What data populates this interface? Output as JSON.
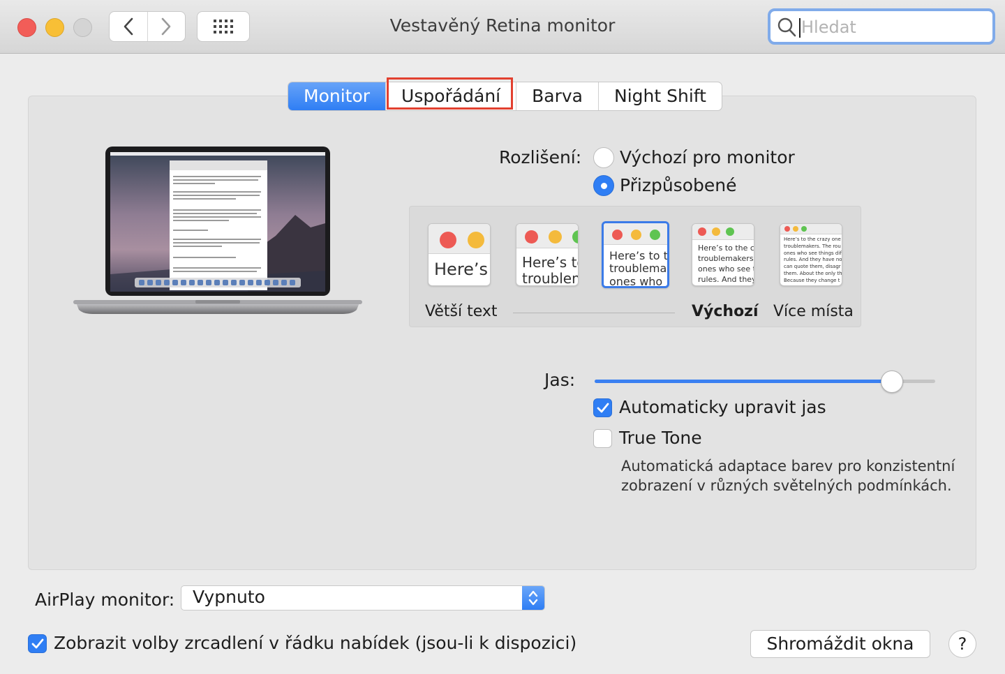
{
  "window": {
    "title": "Vestavěný Retina monitor",
    "search_placeholder": "Hledat",
    "icons": [
      "close-button",
      "minimize-button",
      "zoom-button",
      "chevron-left-icon",
      "chevron-right-icon",
      "grid-icon",
      "search-icon"
    ]
  },
  "tabs": [
    {
      "label": "Monitor",
      "active": true
    },
    {
      "label": "Uspořádání",
      "highlighted": true
    },
    {
      "label": "Barva"
    },
    {
      "label": "Night Shift"
    }
  ],
  "resolution": {
    "label": "Rozlišení:",
    "options": [
      {
        "label": "Výchozí pro monitor",
        "selected": false
      },
      {
        "label": "Přizpůsobené",
        "selected": true
      }
    ],
    "scale_options": [
      {
        "preview_text": "Here’s"
      },
      {
        "preview_text": "Here’s to\ntroublem"
      },
      {
        "preview_text": "Here’s to t\ntroublema\nones who",
        "selected": true
      },
      {
        "preview_text": "Here’s to the cr\ntroublemakers.\nones who see t\nrules. And they"
      },
      {
        "preview_text": "Here’s to the crazy one\ntroublemakers. The rou\nones who see things dif\nrules. And they have no\ncan quote them, disagr\nthem. About the only th\nBecause they change t"
      }
    ],
    "scale_labels": {
      "left": "Větší text",
      "default": "Výchozí",
      "right": "Více místa"
    }
  },
  "brightness": {
    "label": "Jas:",
    "value": 0.87,
    "auto_adjust": {
      "label": "Automaticky upravit jas",
      "checked": true
    },
    "true_tone": {
      "label": "True Tone",
      "checked": false,
      "description_line1": "Automatická adaptace barev pro konzistentní",
      "description_line2": "zobrazení v různých světelných podmínkách."
    }
  },
  "airplay": {
    "label": "AirPlay monitor:",
    "value": "Vypnuto"
  },
  "mirroring": {
    "label": "Zobrazit volby zrcadlení v řádku nabídek (jsou-li k dispozici)",
    "checked": true
  },
  "buttons": {
    "gather_windows": "Shromáždit okna",
    "help": "?"
  },
  "colors": {
    "accent": "#2f7ef4",
    "highlight": "#e2402f"
  }
}
